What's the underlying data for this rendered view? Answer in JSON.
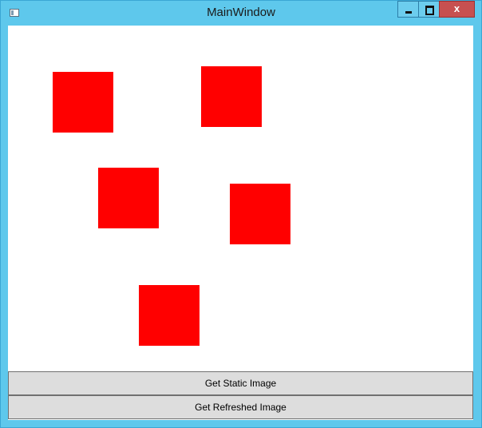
{
  "window": {
    "title": "MainWindow",
    "close_glyph": "x"
  },
  "icons": [
    "app-icon",
    "minimize-icon",
    "maximize-icon",
    "close-icon"
  ],
  "canvas": {
    "shape_color": "#ff0000",
    "shape_count": 5
  },
  "buttons": {
    "static_label": "Get Static Image",
    "refreshed_label": "Get Refreshed Image"
  }
}
